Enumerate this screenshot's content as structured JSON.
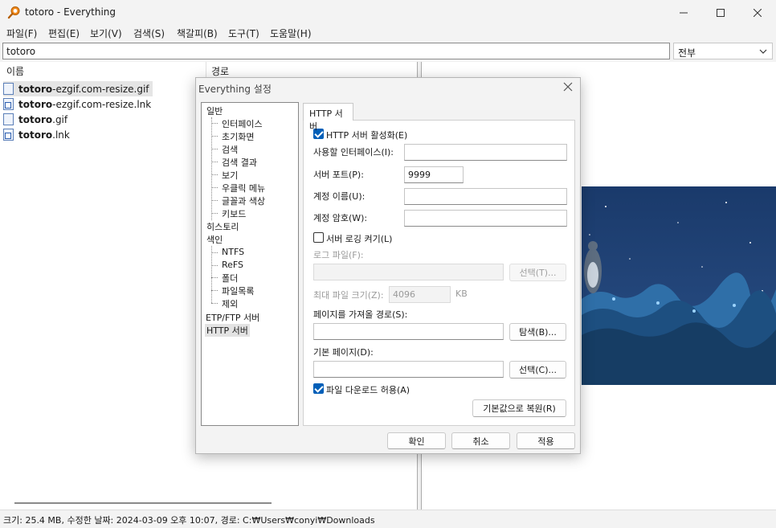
{
  "window": {
    "title": "totoro - Everything"
  },
  "menu": [
    "파일(F)",
    "편집(E)",
    "보기(V)",
    "검색(S)",
    "책갈피(B)",
    "도구(T)",
    "도움말(H)"
  ],
  "search": {
    "value": "totoro",
    "filter": "전부"
  },
  "columns": {
    "name": "이름",
    "path": "경로"
  },
  "files": [
    {
      "bold": "totoro",
      "rest": "-ezgif.com-resize.gif",
      "icon": "gif-file-icon"
    },
    {
      "bold": "totoro",
      "rest": "-ezgif.com-resize.lnk",
      "icon": "shortcut-file-icon"
    },
    {
      "bold": "totoro",
      "rest": ".gif",
      "icon": "gif-file-icon"
    },
    {
      "bold": "totoro",
      "rest": ".lnk",
      "icon": "shortcut-file-icon"
    }
  ],
  "status": "크기: 25.4 MB, 수정한 날짜: 2024-03-09 오후 10:07, 경로: C:₩Users₩conyi₩Downloads",
  "dialog": {
    "title": "Everything 설정",
    "tree": {
      "general": "일반",
      "general_children": [
        "인터페이스",
        "초기화면",
        "검색",
        "검색 결과",
        "보기",
        "우클릭 메뉴",
        "글꼴과 색상",
        "키보드"
      ],
      "history": "히스토리",
      "index": "색인",
      "index_children": [
        "NTFS",
        "ReFS",
        "폴더",
        "파일목록",
        "제외"
      ],
      "etp": "ETP/FTP 서버",
      "http": "HTTP 서버"
    },
    "tab": "HTTP 서버",
    "enable_http": "HTTP 서버 활성화(E)",
    "bind_interfaces_label": "사용할 인터페이스(I):",
    "bind_interfaces_value": "",
    "port_label": "서버 포트(P):",
    "port_value": "9999",
    "username_label": "계정 이름(U):",
    "username_value": "",
    "password_label": "계정 암호(W):",
    "password_value": "",
    "logging": "서버 로깅 켜기(L)",
    "logfile_label": "로그 파일(F):",
    "logfile_value": "",
    "logfile_browse": "선택(T)...",
    "maxsize_label": "최대 파일 크기(Z):",
    "maxsize_value": "4096",
    "maxsize_unit": "KB",
    "serve_path_label": "페이지를 가져올 경로(S):",
    "serve_path_value": "",
    "serve_browse": "탐색(B)...",
    "default_page_label": "기본 페이지(D):",
    "default_page_value": "",
    "default_page_browse": "선택(C)...",
    "allow_download": "파일 다운로드 허용(A)",
    "restore_defaults": "기본값으로 복원(R)",
    "ok": "확인",
    "cancel": "취소",
    "apply": "적용",
    "checks": {
      "enable_http": true,
      "logging": false,
      "allow_download": true
    }
  }
}
